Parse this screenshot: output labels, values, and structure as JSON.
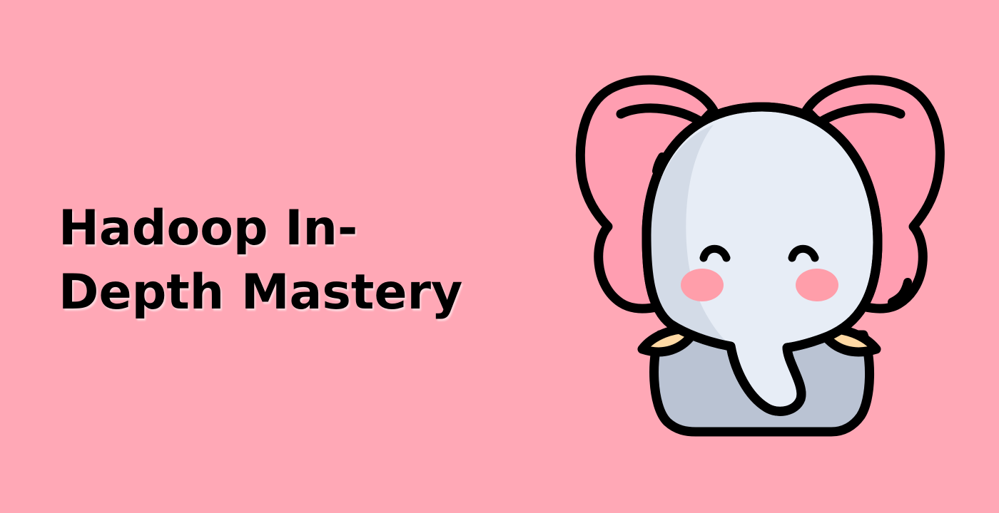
{
  "title": {
    "line1": "Hadoop In-",
    "line2": "Depth Mastery"
  },
  "illustration": {
    "icon": "elephant-icon",
    "colors": {
      "background": "#FFA8B6",
      "skin_light": "#E7EDF6",
      "skin_mid": "#D3DBE7",
      "skin_dark": "#BAC3D3",
      "ear_inner": "#FF9EB1",
      "cheek": "#FF9EAA",
      "tusk": "#FFD9A4",
      "outline": "#000000"
    }
  }
}
